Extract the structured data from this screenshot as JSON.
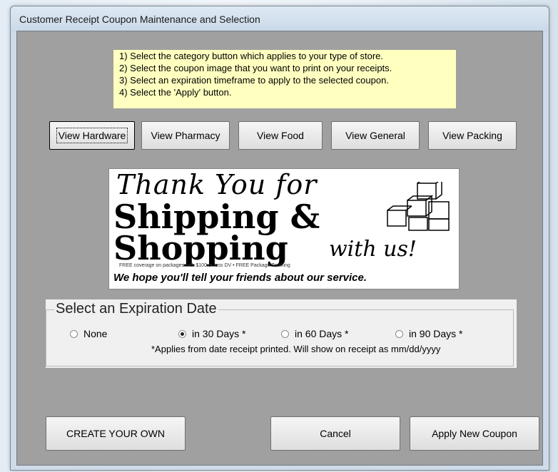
{
  "window": {
    "title": "Customer Receipt Coupon Maintenance and Selection"
  },
  "instructions": [
    "1)  Select the category button which applies to your type of store.",
    "2)  Select the coupon image that you want to print on your receipts.",
    "3)  Select an expiration timeframe to apply to the selected coupon.",
    "4)  Select the 'Apply' button."
  ],
  "categories": [
    {
      "label": "View Hardware"
    },
    {
      "label": "View Pharmacy"
    },
    {
      "label": "View Food"
    },
    {
      "label": "View General"
    },
    {
      "label": "View Packing"
    }
  ],
  "coupon": {
    "line1": "Thank You for",
    "line2": "Shipping &",
    "line3": "Shopping",
    "line3b": "with us!",
    "fine_print": "FREE coverage on packages with $100 or less DV  •  FREE Package Tracking",
    "tagline": "We hope you'll tell your friends about our service."
  },
  "expiration": {
    "title": "Select an Expiration Date",
    "options": [
      {
        "label": "None",
        "checked": false
      },
      {
        "label": "in 30 Days *",
        "checked": true
      },
      {
        "label": "in 60 Days *",
        "checked": false
      },
      {
        "label": "in 90 Days *",
        "checked": false
      }
    ],
    "note": "*Applies from date receipt printed.  Will show on receipt as mm/dd/yyyy"
  },
  "footer": {
    "create_label": "CREATE YOUR OWN",
    "cancel_label": "Cancel",
    "apply_label": "Apply New Coupon"
  }
}
